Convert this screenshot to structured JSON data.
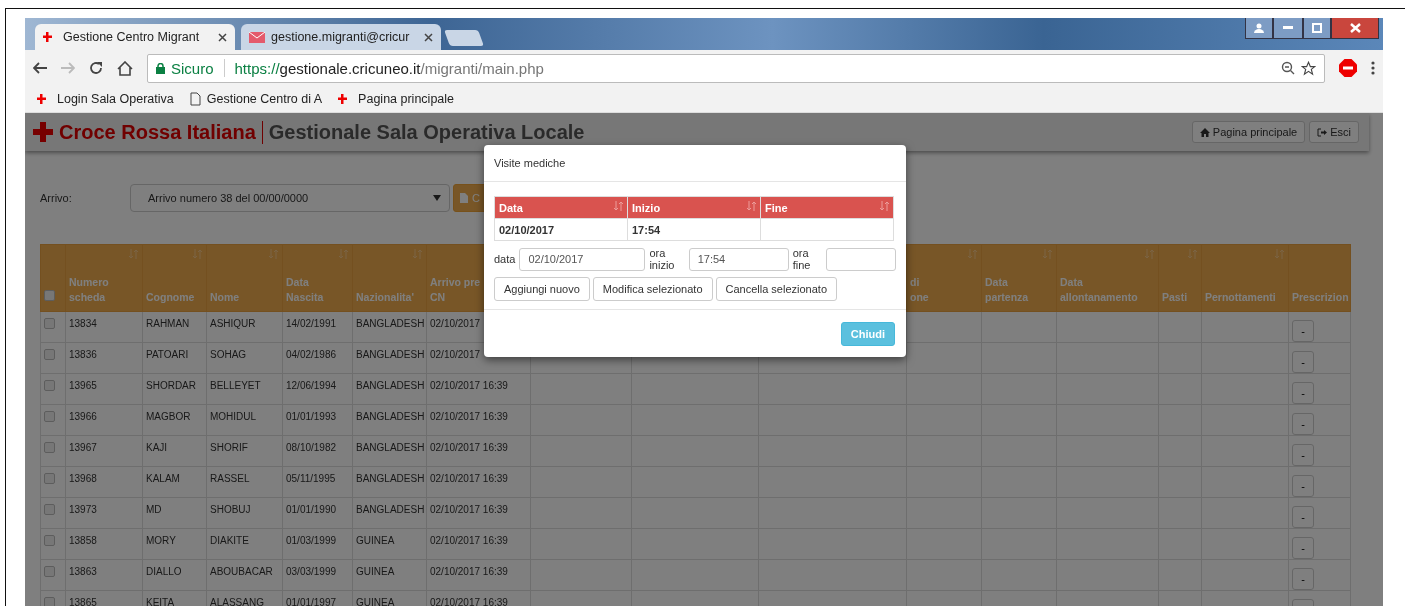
{
  "browser": {
    "tabs": [
      {
        "title": "Gestione Centro Migrant",
        "selected": true,
        "kind": "cri"
      },
      {
        "title": "gestione.migranti@cricur",
        "selected": false,
        "kind": "mail"
      }
    ],
    "security": "Sicuro",
    "url": {
      "scheme": "https://",
      "host": "gestionale.cricuneo.it",
      "path": "/migranti/main.php"
    },
    "bookmarks": [
      {
        "label": "Login Sala Operativa",
        "kind": "cri"
      },
      {
        "label": "Gestione Centro di A",
        "kind": "page"
      },
      {
        "label": "Pagina principale",
        "kind": "cri"
      }
    ]
  },
  "app": {
    "brand": "Croce Rossa Italiana",
    "title": "Gestionale Sala Operativa Locale",
    "nav_buttons": [
      {
        "label": "Pagina principale",
        "kind": "home"
      },
      {
        "label": "Esci",
        "kind": "logout"
      }
    ]
  },
  "filter": {
    "label": "Arrivo:",
    "select_value": "Arrivo numero 38 del 00/00/0000",
    "button_label": "C"
  },
  "table": {
    "select_all": {
      "checked": false
    },
    "columns": [
      {
        "lines": [
          "Numero",
          "scheda"
        ],
        "sortable": true
      },
      {
        "lines": [
          "Cognome"
        ],
        "sortable": true
      },
      {
        "lines": [
          "Nome"
        ],
        "sortable": true
      },
      {
        "lines": [
          "Data",
          "Nascita"
        ],
        "sortable": true
      },
      {
        "lines": [
          "Nazionalita'"
        ],
        "sortable": true
      },
      {
        "lines": [
          "Arrivo pre",
          "CN"
        ]
      },
      {},
      {},
      {},
      {
        "lines": [
          "di",
          "one"
        ],
        "sortable": true
      },
      {
        "lines": [
          "Data",
          "partenza"
        ],
        "sortable": true
      },
      {
        "lines": [
          "Data",
          "allontanamento"
        ],
        "sortable": true
      },
      {
        "lines": [
          "Pasti"
        ],
        "sortable": true
      },
      {
        "lines": [
          "Pernottamenti"
        ],
        "sortable": true
      },
      {
        "lines": [
          "Prescrizion"
        ],
        "sortable": false
      }
    ],
    "rows": [
      {
        "checked": false,
        "cells": [
          "13834",
          "RAHMAN",
          "ASHIQUR",
          "14/02/1991",
          "BANGLADESH",
          "02/10/2017"
        ],
        "action": "-"
      },
      {
        "checked": false,
        "cells": [
          "13836",
          "PATOARI",
          "SOHAG",
          "04/02/1986",
          "BANGLADESH",
          "02/10/2017"
        ],
        "action": "-"
      },
      {
        "checked": false,
        "cells": [
          "13965",
          "SHORDAR",
          "BELLEYET",
          "12/06/1994",
          "BANGLADESH",
          "02/10/2017 16:39"
        ],
        "action": "-"
      },
      {
        "checked": false,
        "cells": [
          "13966",
          "MAGBOR",
          "MOHIDUL",
          "01/01/1993",
          "BANGLADESH",
          "02/10/2017 16:39"
        ],
        "action": "-"
      },
      {
        "checked": false,
        "cells": [
          "13967",
          "KAJI",
          "SHORIF",
          "08/10/1982",
          "BANGLADESH",
          "02/10/2017 16:39"
        ],
        "action": "-"
      },
      {
        "checked": false,
        "cells": [
          "13968",
          "KALAM",
          "RASSEL",
          "05/11/1995",
          "BANGLADESH",
          "02/10/2017 16:39"
        ],
        "action": "-"
      },
      {
        "checked": false,
        "cells": [
          "13973",
          "MD",
          "SHOBUJ",
          "01/01/1990",
          "BANGLADESH",
          "02/10/2017 16:39"
        ],
        "action": "-"
      },
      {
        "checked": false,
        "cells": [
          "13858",
          "MORY",
          "DIAKITE",
          "01/03/1999",
          "GUINEA",
          "02/10/2017 16:39"
        ],
        "action": "-"
      },
      {
        "checked": false,
        "cells": [
          "13863",
          "DIALLO",
          "ABOUBACAR",
          "03/03/1999",
          "GUINEA",
          "02/10/2017 16:39"
        ],
        "action": "-"
      },
      {
        "checked": false,
        "cells": [
          "13865",
          "KEITA",
          "ALASSANG",
          "01/01/1997",
          "GUINEA",
          "02/10/2017 16:39"
        ]
      }
    ]
  },
  "modal": {
    "title": "Visite mediche",
    "columns": [
      "Data",
      "Inizio",
      "Fine"
    ],
    "rows": [
      {
        "cells": [
          "02/10/2017",
          "17:54"
        ]
      }
    ],
    "fields": [
      {
        "label": "data",
        "value": "02/10/2017"
      },
      {
        "label": "ora inizio",
        "value": "17:54"
      },
      {
        "label": "ora fine"
      }
    ],
    "buttons": [
      "Aggiungi nuovo",
      "Modifica selezionato",
      "Cancella selezionato"
    ],
    "close_label": "Chiudi"
  }
}
